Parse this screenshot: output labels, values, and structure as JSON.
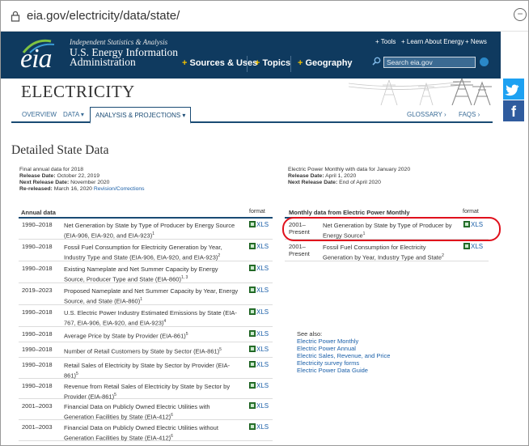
{
  "browser": {
    "url": "eia.gov/electricity/data/state/",
    "minus": "−"
  },
  "header": {
    "logo": "eia",
    "tagline": "Independent Statistics & Analysis",
    "agency_line1": "U.S. Energy Information",
    "agency_line2": "Administration",
    "top_links": [
      "+ Tools",
      "+ Learn About Energy",
      "+ News"
    ],
    "main_nav": [
      "Sources & Uses",
      "Topics",
      "Geography"
    ],
    "search_placeholder": "Search eia.gov"
  },
  "social": {
    "facebook": "f"
  },
  "page": {
    "title": "ELECTRICITY",
    "subnav": {
      "overview": "OVERVIEW",
      "data": "DATA ▾",
      "analysis": "ANALYSIS & PROJECTIONS ▾",
      "glossary": "GLOSSARY ›",
      "faqs": "FAQS ›"
    },
    "section_title": "Detailed State Data"
  },
  "annual_meta": {
    "line1": "Final annual data for 2018",
    "release_label": "Release Date:",
    "release_value": "October 22, 2019",
    "next_label": "Next Release Date:",
    "next_value": "November 2020",
    "rereleased_label": "Re-released:",
    "rereleased_value": "March 16, 2020",
    "revision_link": "Revision/Corrections"
  },
  "monthly_meta": {
    "line1": "Electric Power Monthly with data for January 2020",
    "release_label": "Release Date:",
    "release_value": "April 1, 2020",
    "next_label": "Next Release Date:",
    "next_value": "End of April 2020"
  },
  "annual_table": {
    "header": "Annual data",
    "format": "format",
    "rows": [
      {
        "years": "1990–2018",
        "l1": "Net Generation by State by Type of Producer by Energy Source",
        "l2": "(EIA-906, EIA-920, and EIA-923)",
        "sup": "1"
      },
      {
        "years": "1990–2018",
        "l1": "Fossil Fuel Consumption for Electricity Generation by Year,",
        "l2": "Industry Type and State (EIA-906, EIA-920, and EIA-923)",
        "sup": "2"
      },
      {
        "years": "1990–2018",
        "l1": "Existing Nameplate and Net Summer Capacity by Energy",
        "l2": "Source, Producer Type and State (EIA-860)",
        "sup": "1, 3"
      },
      {
        "years": "2019–2023",
        "l1": "Proposed Nameplate and Net Summer Capacity by Year, Energy",
        "l2": "Source, and State (EIA-860)",
        "sup": "1"
      },
      {
        "years": "1990–2018",
        "l1": "U.S. Electric Power Industry Estimated Emissions by State (EIA-",
        "l2": "767, EIA-906, EIA-920, and EIA-923)",
        "sup": "4"
      },
      {
        "years": "1990–2018",
        "l1": "Average Price by State by Provider (EIA-861)",
        "l2": "",
        "sup": "5"
      },
      {
        "years": "1990–2018",
        "l1": "Number of Retail Customers by State by Sector (EIA-861)",
        "l2": "",
        "sup": "5"
      },
      {
        "years": "1990–2018",
        "l1": "Retail Sales of Electricity by State by Sector by Provider (EIA-",
        "l2": "861)",
        "sup": "5"
      },
      {
        "years": "1990–2018",
        "l1": "Revenue from Retail Sales of Electricity by State by Sector by",
        "l2": "Provider (EIA-861)",
        "sup": "5"
      },
      {
        "years": "2001–2003",
        "l1": "Financial Data on Publicly Owned Electric Utilities with",
        "l2": "Generation Facilities by State (EIA-412)",
        "sup": "6"
      },
      {
        "years": "2001–2003",
        "l1": "Financial Data on Publicly Owned Electric Utilities without",
        "l2": "Generation Facilities by State (EIA-412)",
        "sup": "6"
      }
    ],
    "xls": "XLS"
  },
  "monthly_table": {
    "header": "Monthly data from Electric Power Monthly",
    "format": "format",
    "rows": [
      {
        "years1": "2001–",
        "years2": "Present",
        "l1": "Net Generation by State by Type of Producer by Energy Source",
        "l2": "Energy Source",
        "sup": "1"
      },
      {
        "years1": "2001–",
        "years2": "Present",
        "l1": "Fossil Fuel Consumption for Electricity",
        "l2": "Generation by Year, Industry Type and State",
        "sup": "2"
      }
    ],
    "xls": "XLS"
  },
  "see_also": {
    "label": "See also:",
    "links": [
      "Electric Power Monthly",
      "Electric Power Annual",
      "Electric Sales, Revenue, and Price",
      "Electricity survey forms",
      "Electric Power Data Guide"
    ]
  }
}
